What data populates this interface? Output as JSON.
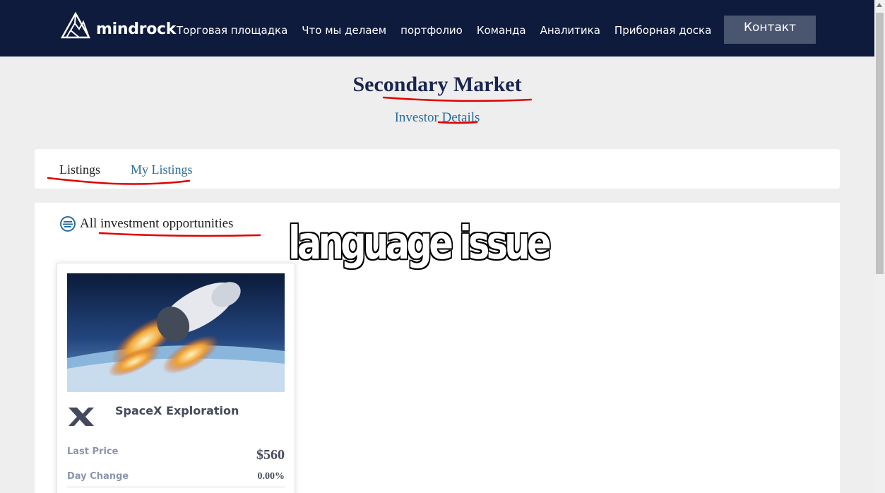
{
  "header": {
    "logo_text": "mindrock",
    "nav": [
      "Торговая площадка",
      "Что мы делаем",
      "портфолио",
      "Команда",
      "Аналитика",
      "Приборная доска"
    ],
    "contact_label": "Контакт",
    "background_color": "#0f1b3d"
  },
  "page": {
    "title": "Secondary Market",
    "subtitle": "Investor Details"
  },
  "tabs": {
    "listings": "Listings",
    "my_listings": "My Listings"
  },
  "section": {
    "title": "All investment opportunities",
    "icon": "list-circle-icon"
  },
  "listing": {
    "company": "SpaceX Exploration",
    "logo_icon": "spacex-x-icon",
    "image": "spacecraft-launch-image",
    "last_price_label": "Last Price",
    "last_price": "$560",
    "day_change_label": "Day Change",
    "day_change": "0.00%"
  },
  "annotation": {
    "text": "language issue",
    "markup_color": "#e00000"
  }
}
